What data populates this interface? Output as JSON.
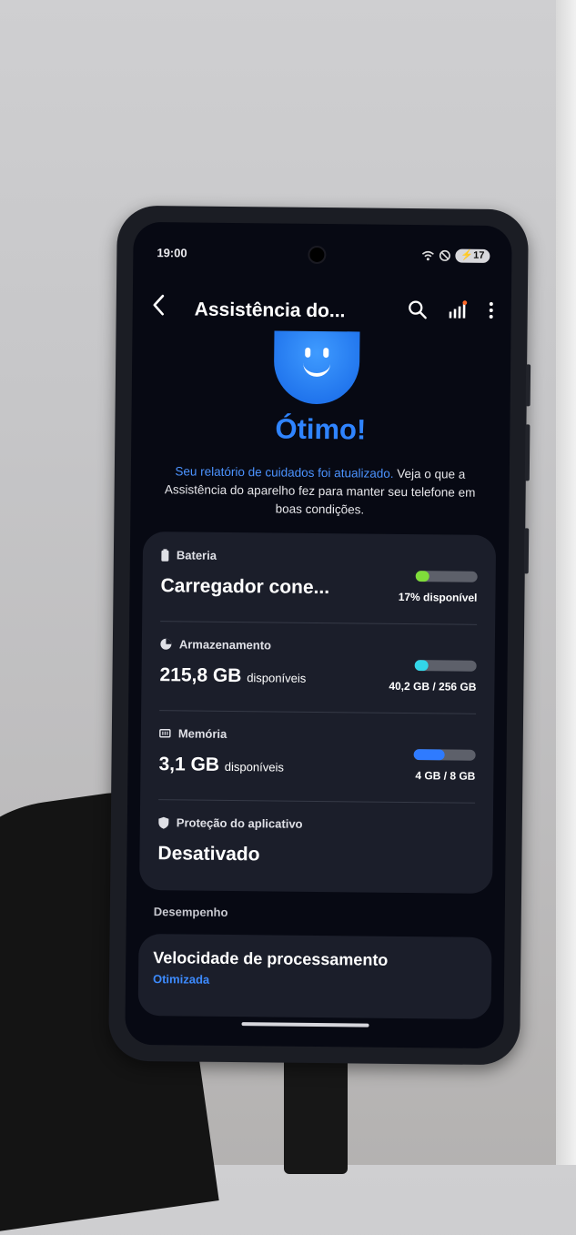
{
  "status_bar": {
    "time": "19:00",
    "battery_level": "17"
  },
  "app_bar": {
    "back_icon": "chevron-left-icon",
    "title": "Assistência do...",
    "search_icon": "search-icon",
    "diagnostics_icon": "signal-bars-icon",
    "more_icon": "more-vert-icon"
  },
  "hero": {
    "headline": "Ótimo!",
    "desc_highlight": "Seu relatório de cuidados foi atualizado.",
    "desc_rest": " Veja o que a Assistência do aparelho fez para manter seu telefone em boas condições."
  },
  "items": [
    {
      "label": "Bateria",
      "value": "Carregador cone...",
      "unit": "",
      "detail": "17% disponível",
      "fill": 0.17,
      "color": "#7fdc3a"
    },
    {
      "label": "Armazenamento",
      "value": "215,8 GB",
      "unit": "disponíveis",
      "detail": "40,2 GB / 256 GB",
      "fill": 0.157,
      "color": "#33d6e8"
    },
    {
      "label": "Memória",
      "value": "3,1 GB",
      "unit": "disponíveis",
      "detail": "4 GB / 8 GB",
      "fill": 0.5,
      "color": "#2f7bff"
    },
    {
      "label": "Proteção do aplicativo",
      "value": "Desativado"
    }
  ],
  "performance": {
    "section_label": "Desempenho",
    "title": "Velocidade de processamento",
    "status": "Otimizada"
  }
}
